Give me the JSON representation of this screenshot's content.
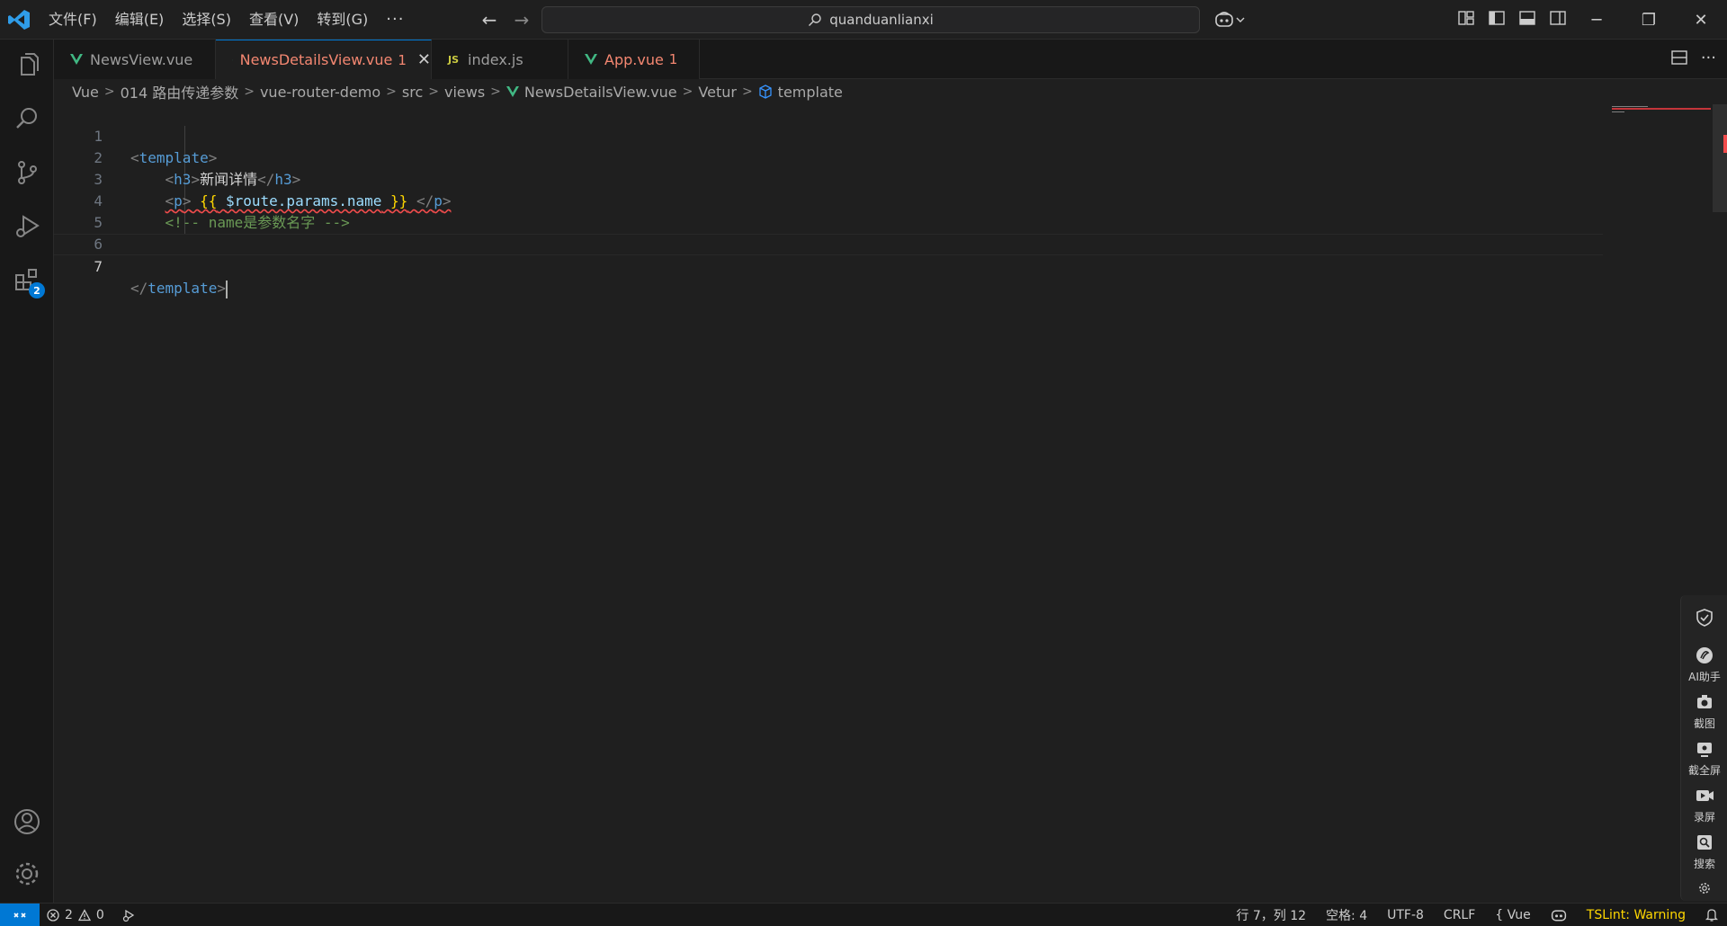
{
  "menu": {
    "items": [
      "文件(F)",
      "编辑(E)",
      "选择(S)",
      "查看(V)",
      "转到(G)"
    ],
    "more": "···"
  },
  "search": {
    "text": "quanduanlianxi"
  },
  "tabs": [
    {
      "label": "NewsView.vue",
      "icon": "vue-icon",
      "active": false
    },
    {
      "label": "NewsDetailsView.vue",
      "count": "1",
      "icon": "vue-icon",
      "active": true
    },
    {
      "label": "index.js",
      "icon": "js-icon",
      "icon_text": "JS",
      "active": false
    },
    {
      "label": "App.vue",
      "count": "1",
      "icon": "vue-icon",
      "active": false
    }
  ],
  "breadcrumb": [
    "Vue",
    "014 路由传递参数",
    "vue-router-demo",
    "src",
    "views",
    "NewsDetailsView.vue",
    "Vetur",
    "template"
  ],
  "editor": {
    "line_numbers": [
      "1",
      "2",
      "3",
      "4",
      "5",
      "6",
      "7"
    ],
    "lines": {
      "l1_tag": "template",
      "l2_tag": "h3",
      "l2_text": "新闻详情",
      "l3_tag": "p",
      "l3_open_brace": "{{",
      "l3_expr": "$route.params.name",
      "l3_close_brace": "}}",
      "l4_comment": "<!-- name是参数名字 -->",
      "l7_tag": "template"
    }
  },
  "tools": [
    {
      "icon": "shield-check-icon",
      "label": ""
    },
    {
      "icon": "ai-assistant-icon",
      "label": "AI助手"
    },
    {
      "icon": "camera-icon",
      "label": "截图"
    },
    {
      "icon": "fullscreen-capture-icon",
      "label": "截全屏"
    },
    {
      "icon": "video-record-icon",
      "label": "录屏"
    },
    {
      "icon": "image-search-icon",
      "label": "搜索"
    }
  ],
  "status": {
    "errors": "2",
    "warnings": "0",
    "position": "行 7，列 12",
    "spaces": "空格: 4",
    "encoding": "UTF-8",
    "eol": "CRLF",
    "language": "Vue",
    "tslint": "TSLint: Warning"
  },
  "colors": {
    "accent": "#0078d4",
    "error": "#f48771",
    "vue_green": "#41b883",
    "js_yellow": "#cbcb41"
  }
}
